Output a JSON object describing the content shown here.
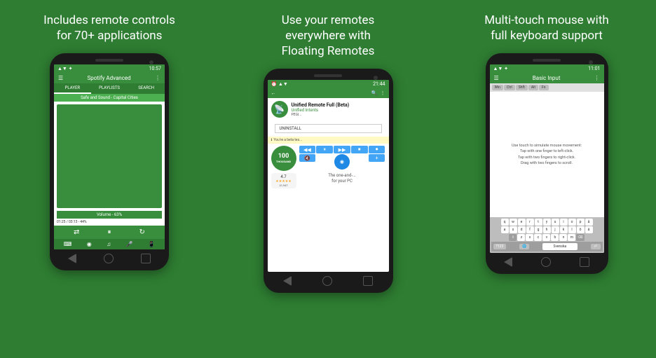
{
  "panels": [
    {
      "id": "panel1",
      "title": "Includes remote controls\nfor 70+ applications",
      "phone": {
        "status_time": "10:57",
        "app_name": "Spotify Advanced",
        "tabs": [
          "PLAYER",
          "PLAYLISTS",
          "SEARCH"
        ],
        "active_tab": 0,
        "track": "Safe and Sound - Capital Cities",
        "volume": "Volume - 63%",
        "progress": "01:25 / 03:13 - 44%"
      }
    },
    {
      "id": "panel2",
      "title": "Use your remotes\neverywhere with\nFloating Remotes",
      "phone": {
        "status_time": "21:44",
        "app_name": "Unified Remote Full (Beta)",
        "developer": "Unified Intents",
        "rating": "4.7",
        "downloads": "100",
        "downloads_label": "THOUSAND",
        "downloads_count": "31,947",
        "uninstall": "UNINSTALL",
        "beta_text": "You're a beta tes...",
        "desc": "The one-and-...\nfor your PC"
      }
    },
    {
      "id": "panel3",
      "title": "Multi-touch mouse with\nfull keyboard support",
      "phone": {
        "status_time": "11:01",
        "app_name": "Basic Input",
        "keyboard_special": [
          "Win",
          "Ctrl",
          "Shift",
          "Alt",
          "Fn"
        ],
        "mouse_instructions": [
          "Use touch to simulate mouse movement:",
          "Tap with one finger to left-click.",
          "Tap with two fingers to right-click.",
          "Drag with two fingers to scroll."
        ],
        "keyboard_rows": [
          [
            "q",
            "w",
            "e",
            "r",
            "t",
            "y",
            "u",
            "i",
            "o",
            "p",
            "å"
          ],
          [
            "a",
            "s",
            "d",
            "f",
            "g",
            "h",
            "j",
            "k",
            "l",
            "ö",
            "ä"
          ],
          [
            "⇧",
            "z",
            "x",
            "c",
            "v",
            "b",
            "n",
            "m",
            "⌫"
          ],
          [
            "?123",
            "🌐",
            "",
            "",
            "",
            "",
            "Svenska",
            "⏎"
          ]
        ],
        "kb_bottom": [
          "?123",
          "🌐",
          "Svenska",
          "⏎"
        ]
      }
    }
  ],
  "colors": {
    "green_dark": "#2e7d32",
    "green_mid": "#388e3c",
    "green_light": "#4caf50",
    "white": "#ffffff",
    "blue": "#42a5f5"
  }
}
